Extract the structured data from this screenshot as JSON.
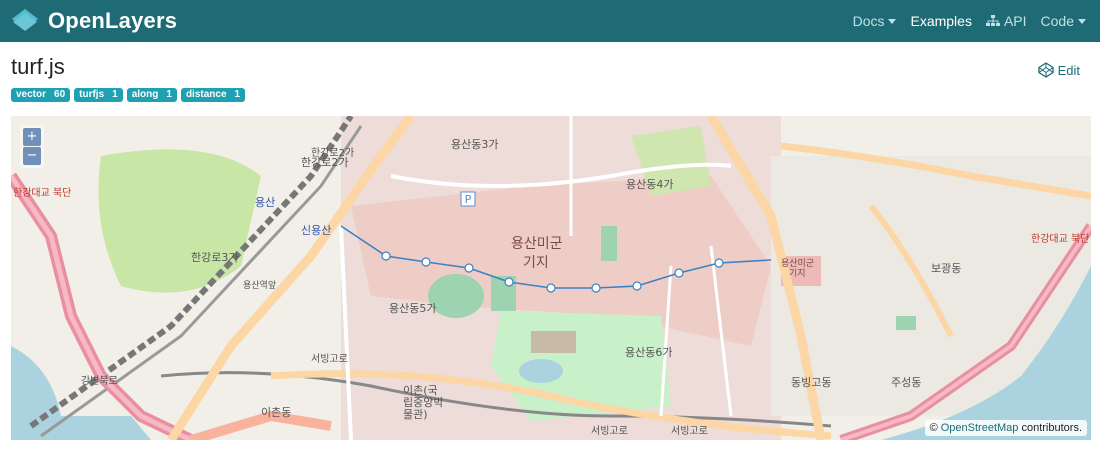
{
  "brand": {
    "name": "OpenLayers"
  },
  "nav": {
    "docs": "Docs",
    "examples": "Examples",
    "api": "API",
    "code": "Code"
  },
  "page": {
    "title": "turf.js",
    "edit": "Edit"
  },
  "tags": [
    {
      "name": "vector",
      "count": "60"
    },
    {
      "name": "turfjs",
      "count": "1"
    },
    {
      "name": "along",
      "count": "1"
    },
    {
      "name": "distance",
      "count": "1"
    }
  ],
  "map": {
    "zoom_in": "+",
    "zoom_out": "−",
    "attribution_prefix": "©",
    "attribution_link": "OpenStreetMap",
    "attribution_suffix": "contributors.",
    "labels": [
      "용산동3가",
      "용산동4가",
      "용산미군",
      "기지",
      "용산동5가",
      "용산동6가",
      "한강로2가",
      "한강로3가",
      "보광동",
      "동빙고동",
      "주성동",
      "이촌동",
      "신용산",
      "용산",
      "서빙고로",
      "이촌(국",
      "립중앙박",
      "물관)",
      "용산역앞",
      "용산미군",
      "기지",
      "한강대교 북단",
      "한강대교 북단",
      "서빙고로",
      "서빙고로",
      "한강로2가",
      "강변북로"
    ],
    "colors": {
      "route": "#3b82c4",
      "route_point": "#ffffff",
      "water": "#aad3df",
      "park": "#c8e6a6",
      "military": "#f4c3c3",
      "motorway": "#e990a0",
      "trunk": "#f9b29c",
      "primary": "#fcd6a4",
      "rail": "#777777"
    }
  }
}
